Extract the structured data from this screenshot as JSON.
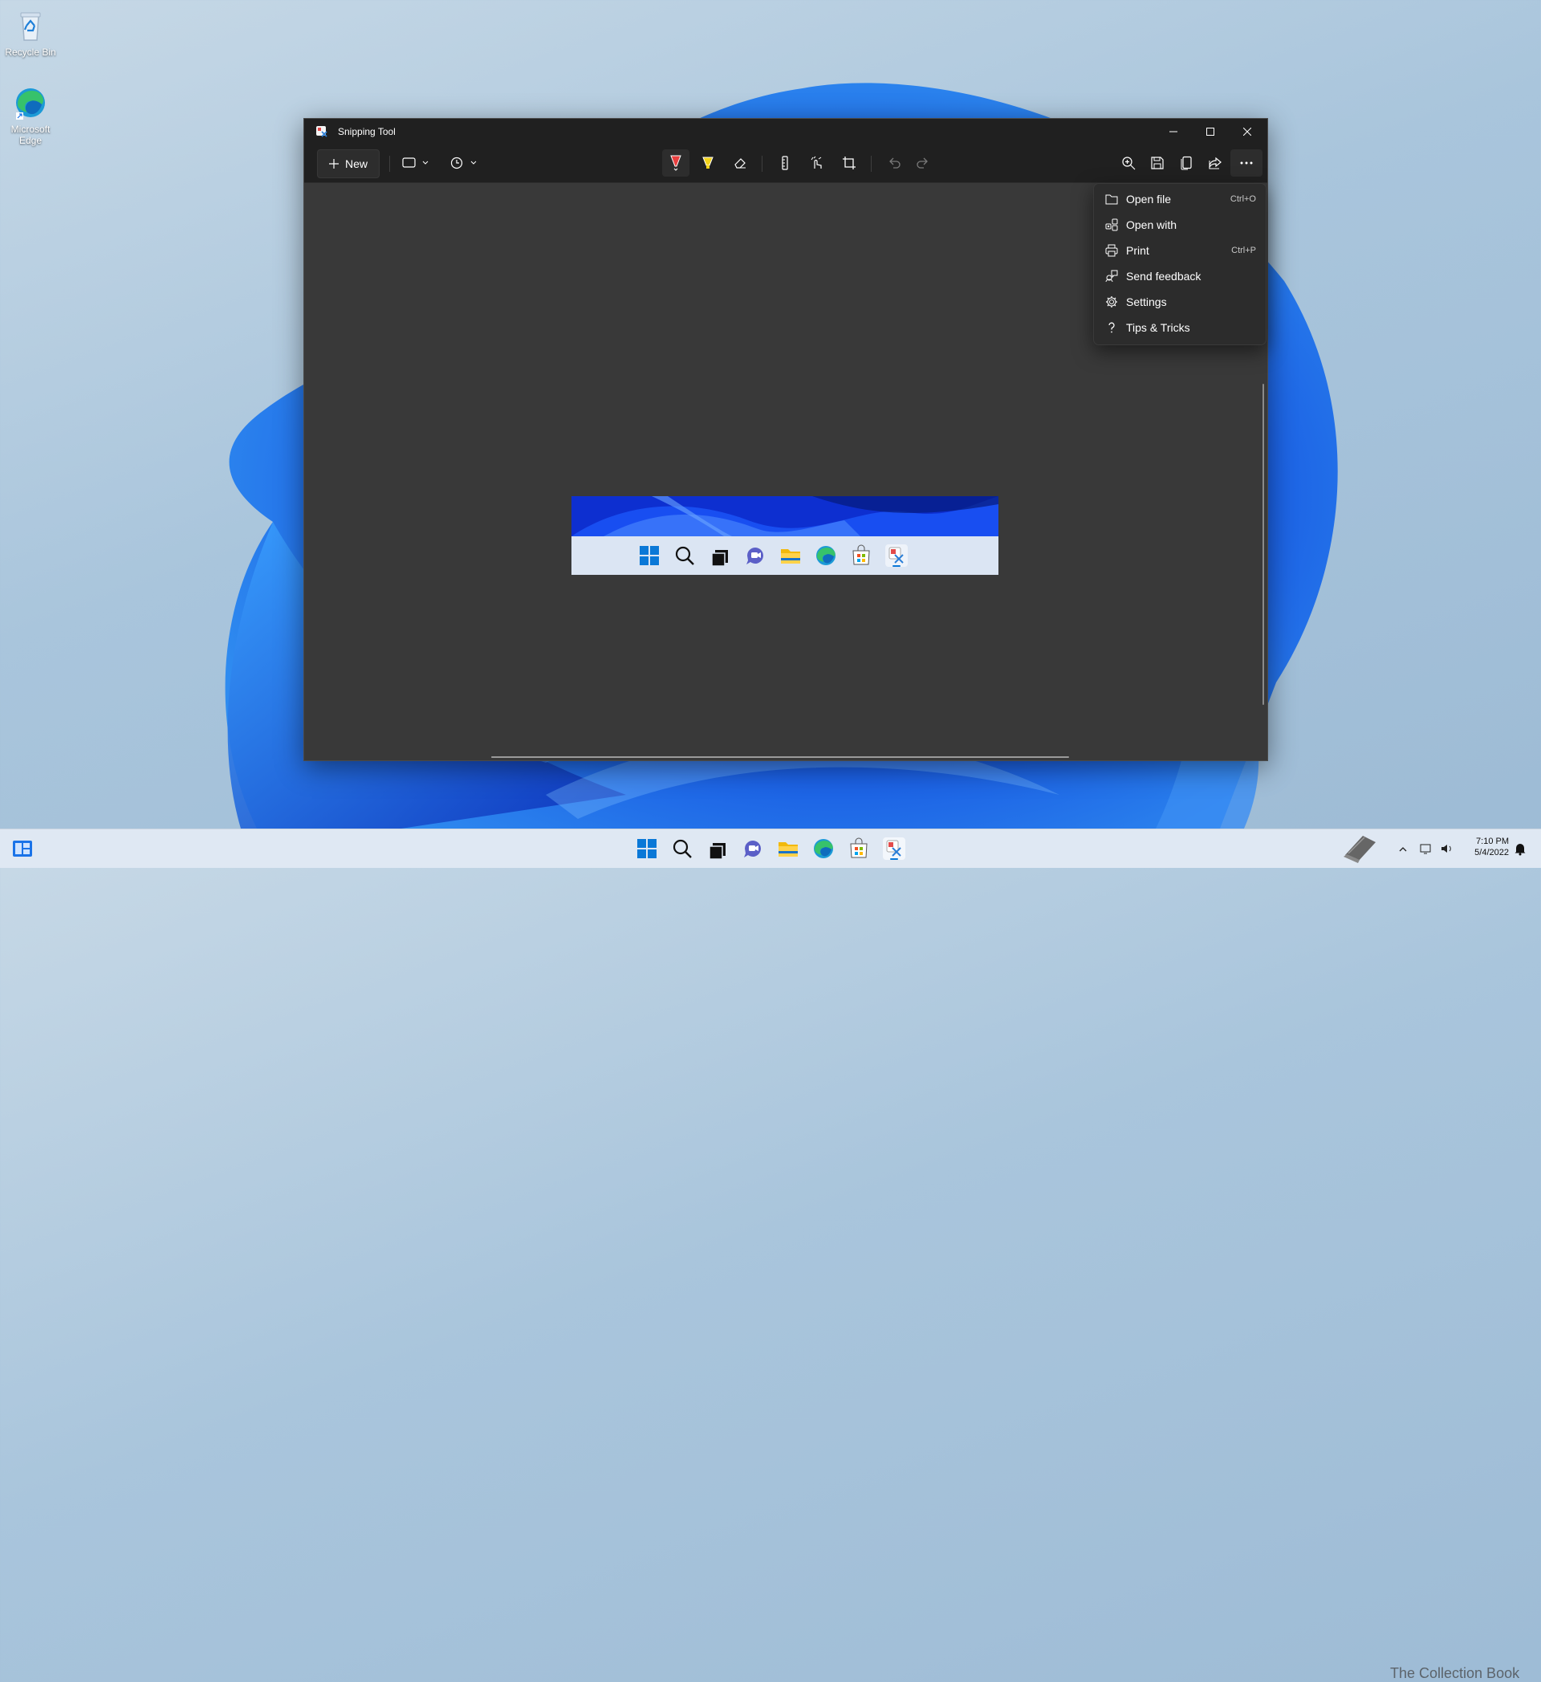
{
  "desktop": {
    "icons": [
      {
        "label": "Recycle Bin",
        "icon": "recycle-bin-icon"
      },
      {
        "label": "Microsoft Edge",
        "icon": "edge-icon"
      }
    ]
  },
  "window": {
    "title": "Snipping Tool",
    "controls": [
      "minimize-icon",
      "maximize-icon",
      "close-icon"
    ]
  },
  "toolbar": {
    "new_label": "New",
    "left_tools": [
      "snip-mode-rectangle-icon",
      "delay-timer-icon"
    ],
    "center_tools": [
      "ballpoint-pen-icon",
      "highlighter-icon",
      "eraser-icon",
      "ruler-icon",
      "touch-writing-icon",
      "crop-icon",
      "undo-icon",
      "redo-icon"
    ],
    "right_tools": [
      "zoom-icon",
      "save-icon",
      "copy-icon",
      "share-icon",
      "more-icon"
    ]
  },
  "menu": {
    "items": [
      {
        "label": "Open file",
        "shortcut": "Ctrl+O",
        "icon": "folder-icon"
      },
      {
        "label": "Open with",
        "shortcut": "",
        "icon": "open-with-icon"
      },
      {
        "label": "Print",
        "shortcut": "Ctrl+P",
        "icon": "printer-icon"
      },
      {
        "label": "Send feedback",
        "shortcut": "",
        "icon": "feedback-icon"
      },
      {
        "label": "Settings",
        "shortcut": "",
        "icon": "gear-icon"
      },
      {
        "label": "Tips & Tricks",
        "shortcut": "",
        "icon": "question-icon"
      }
    ]
  },
  "taskbar": {
    "apps": [
      "start-icon",
      "search-icon",
      "task-view-icon",
      "chat-icon",
      "file-explorer-icon",
      "edge-icon",
      "store-icon",
      "snipping-tool-icon"
    ],
    "tray": {
      "time": "7:10 PM",
      "date": "5/4/2022"
    },
    "watermark": "The Collection Book"
  },
  "colors": {
    "accent": "#0067c0",
    "window_bg": "#393939",
    "titlebar": "#202020",
    "menu_bg": "#2c2c2c"
  }
}
